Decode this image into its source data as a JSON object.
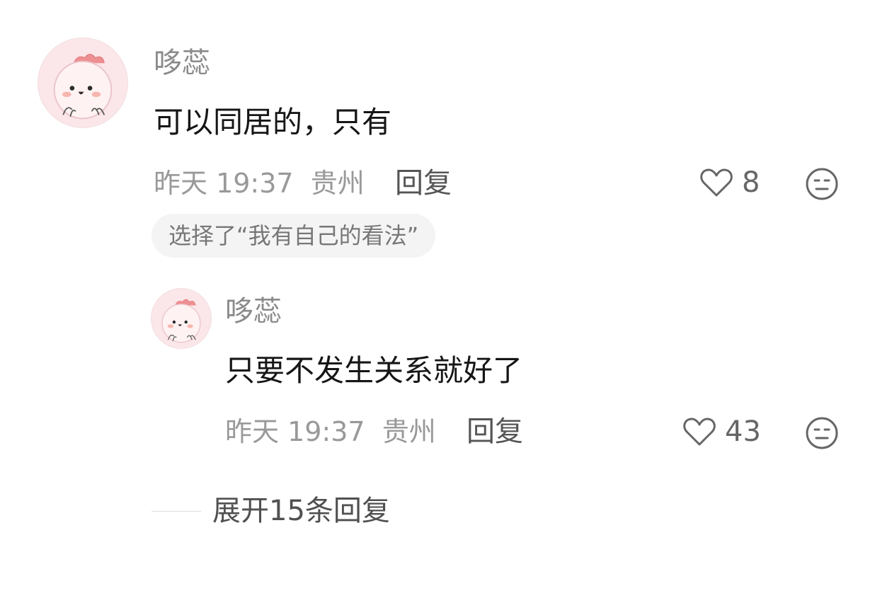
{
  "comment": {
    "username": "哆蕊",
    "text": "可以同居的，只有",
    "time": "昨天 19:37",
    "location": "贵州",
    "reply_label": "回复",
    "likes": "8",
    "tag": "选择了“我有自己的看法”",
    "avatar_icon": "avatar-cartoon-pink",
    "like_icon": "heart-outline-icon",
    "dislike_icon": "meh-face-icon"
  },
  "reply": {
    "username": "哆蕊",
    "text": "只要不发生关系就好了",
    "time": "昨天 19:37",
    "location": "贵州",
    "reply_label": "回复",
    "likes": "43"
  },
  "expand": {
    "label": "展开15条回复"
  },
  "colors": {
    "username": "#8a8a8a",
    "content": "#161616",
    "meta": "#999999",
    "tag_bg": "#f4f4f4",
    "avatar_bg": "#fbe5e8"
  }
}
